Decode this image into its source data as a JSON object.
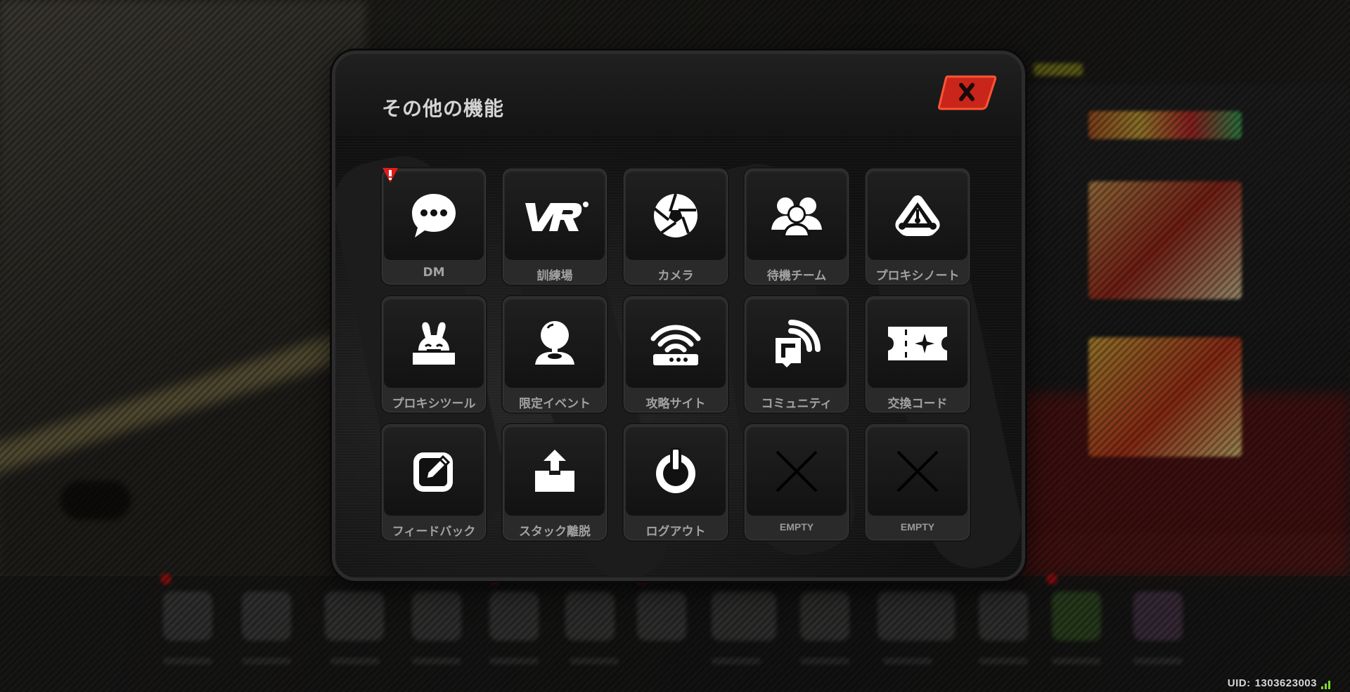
{
  "dialog": {
    "title": "その他の機能",
    "close_icon": "close-x-icon"
  },
  "tiles": [
    {
      "id": "dm",
      "label": "DM",
      "icon": "chat-bubble-icon",
      "alert": true
    },
    {
      "id": "training",
      "label": "訓練場",
      "icon": "vr-icon",
      "alert": false
    },
    {
      "id": "camera",
      "label": "カメラ",
      "icon": "camera-aperture-icon",
      "alert": false
    },
    {
      "id": "standby-team",
      "label": "待機チーム",
      "icon": "team-icon",
      "alert": false
    },
    {
      "id": "proxy-note",
      "label": "プロキシノート",
      "icon": "proxy-note-icon",
      "alert": false
    },
    {
      "id": "proxy-tool",
      "label": "プロキシツール",
      "icon": "rabbit-tool-icon",
      "alert": false
    },
    {
      "id": "limited-event",
      "label": "限定イベント",
      "icon": "joystick-icon",
      "alert": false
    },
    {
      "id": "guide-site",
      "label": "攻略サイト",
      "icon": "router-icon",
      "alert": false
    },
    {
      "id": "community",
      "label": "コミュニティ",
      "icon": "community-icon",
      "alert": false
    },
    {
      "id": "exchange-code",
      "label": "交換コード",
      "icon": "ticket-icon",
      "alert": false
    },
    {
      "id": "feedback",
      "label": "フィードバック",
      "icon": "edit-icon",
      "alert": false
    },
    {
      "id": "stack-escape",
      "label": "スタック離脱",
      "icon": "upload-box-icon",
      "alert": false
    },
    {
      "id": "logout",
      "label": "ログアウト",
      "icon": "power-icon",
      "alert": false
    },
    {
      "id": "empty-1",
      "label": "EMPTY",
      "icon": "empty-x-icon",
      "alert": false
    },
    {
      "id": "empty-2",
      "label": "EMPTY",
      "icon": "empty-x-icon",
      "alert": false
    }
  ],
  "footer": {
    "uid_label": "UID:",
    "uid_value": "1303623003",
    "signal_icon": "signal-bars-icon"
  },
  "colors": {
    "accent_red": "#d42b1a",
    "alert_red": "#e11b1b",
    "signal_green": "#7bdc2a"
  }
}
